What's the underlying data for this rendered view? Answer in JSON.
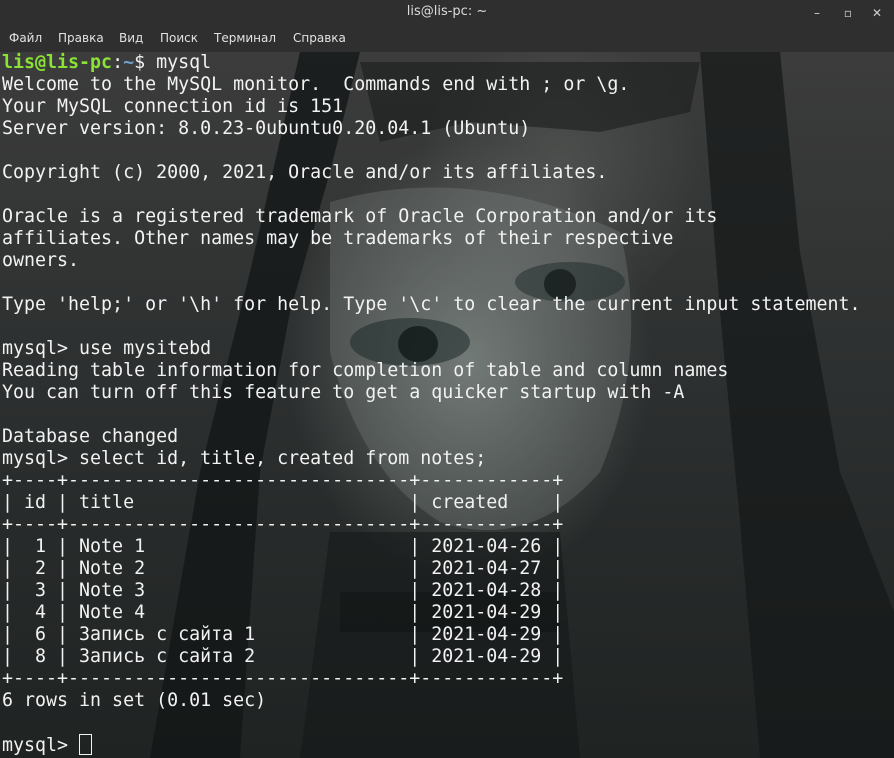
{
  "window": {
    "title": "lis@lis-pc: ~",
    "minimize_glyph": "–",
    "maximize_glyph": "▫",
    "close_glyph": "✕"
  },
  "menu": [
    "Файл",
    "Правка",
    "Вид",
    "Поиск",
    "Терминал",
    "Справка"
  ],
  "prompt": {
    "user_host": "lis@lis-pc",
    "path_sep": ":",
    "path": "~",
    "symbol": "$ ",
    "command": "mysql"
  },
  "lines": [
    "Welcome to the MySQL monitor.  Commands end with ; or \\g.",
    "Your MySQL connection id is 151",
    "Server version: 8.0.23-0ubuntu0.20.04.1 (Ubuntu)",
    "",
    "Copyright (c) 2000, 2021, Oracle and/or its affiliates.",
    "",
    "Oracle is a registered trademark of Oracle Corporation and/or its",
    "affiliates. Other names may be trademarks of their respective",
    "owners.",
    "",
    "Type 'help;' or '\\h' for help. Type '\\c' to clear the current input statement.",
    "",
    "mysql> use mysitebd",
    "Reading table information for completion of table and column names",
    "You can turn off this feature to get a quicker startup with -A",
    "",
    "Database changed",
    "mysql> select id, title, created from notes;",
    "+----+-------------------------------+------------+",
    "| id | title                         | created    |",
    "+----+-------------------------------+------------+",
    "|  1 | Note 1                        | 2021-04-26 |",
    "|  2 | Note 2                        | 2021-04-27 |",
    "|  3 | Note 3                        | 2021-04-28 |",
    "|  4 | Note 4                        | 2021-04-29 |",
    "|  6 | Запись с сайта 1              | 2021-04-29 |",
    "|  8 | Запись с сайта 2              | 2021-04-29 |",
    "+----+-------------------------------+------------+",
    "6 rows in set (0.01 sec)",
    ""
  ],
  "final_prompt": "mysql> ",
  "colors": {
    "prompt_user": "#8ae234",
    "prompt_path": "#729fcf",
    "text": "#f2f2f2"
  }
}
